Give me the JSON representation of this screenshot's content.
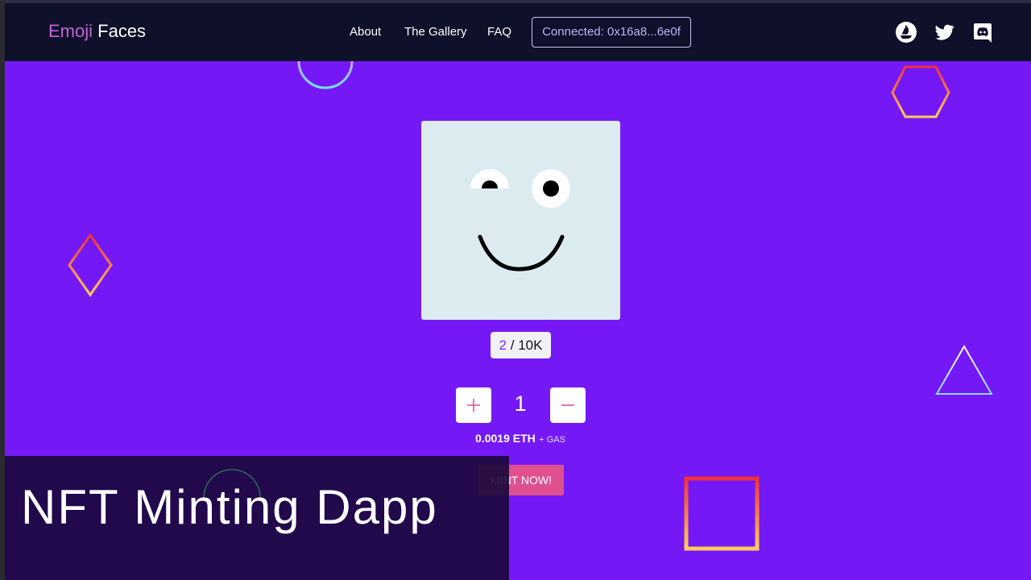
{
  "brand": {
    "part1": "Emoji",
    "part2": "Faces"
  },
  "nav": {
    "about": "About",
    "gallery": "The Gallery",
    "faq": "FAQ",
    "connected": "Connected: 0x16a8...6e0f"
  },
  "icons": {
    "opensea": "opensea-icon",
    "twitter": "twitter-icon",
    "discord": "discord-icon",
    "plus": "plus-icon",
    "minus": "minus-icon"
  },
  "mint": {
    "minted": "2",
    "separator": " / ",
    "supply": "10K",
    "quantity": "1",
    "price": "0.0019 ETH",
    "gas": "+ GAS",
    "button": "MINT NOW!"
  },
  "overlay": {
    "title": "NFT Minting Dapp"
  },
  "colors": {
    "background": "#7419f5",
    "navbar": "#0f1029",
    "brand_accent": "#c463d9",
    "mint_button": "#e0508f"
  }
}
